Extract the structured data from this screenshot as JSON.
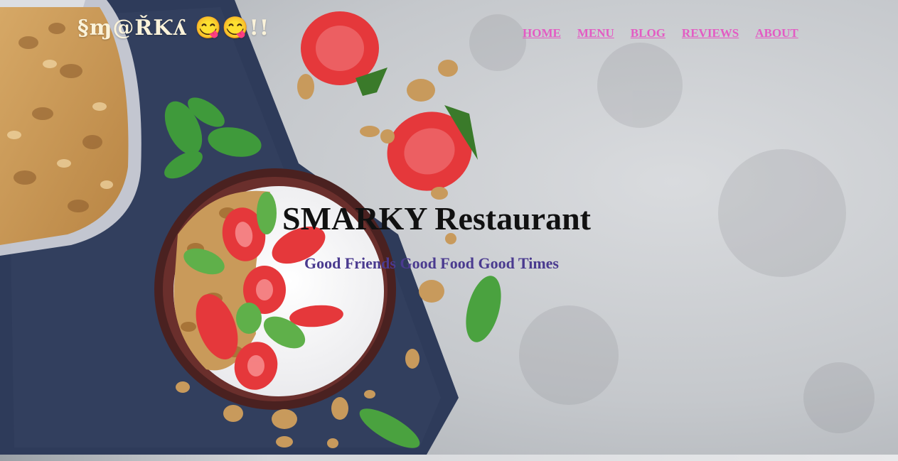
{
  "brand": {
    "logo_text": "§ɱ@ŘƘʎ 😋😋!!"
  },
  "nav": {
    "items": [
      {
        "label": "HOME"
      },
      {
        "label": "MENU"
      },
      {
        "label": "BLOG"
      },
      {
        "label": "REVIEWS"
      },
      {
        "label": "ABOUT"
      }
    ],
    "link_color": "#e35bc3"
  },
  "hero": {
    "title": "SMARKY Restaurant",
    "tagline": "Good Friends Good Food Good Times",
    "title_color": "#111111",
    "tagline_color": "#4a3a8f",
    "image": "granola-yogurt-strawberry-bowl-background"
  }
}
